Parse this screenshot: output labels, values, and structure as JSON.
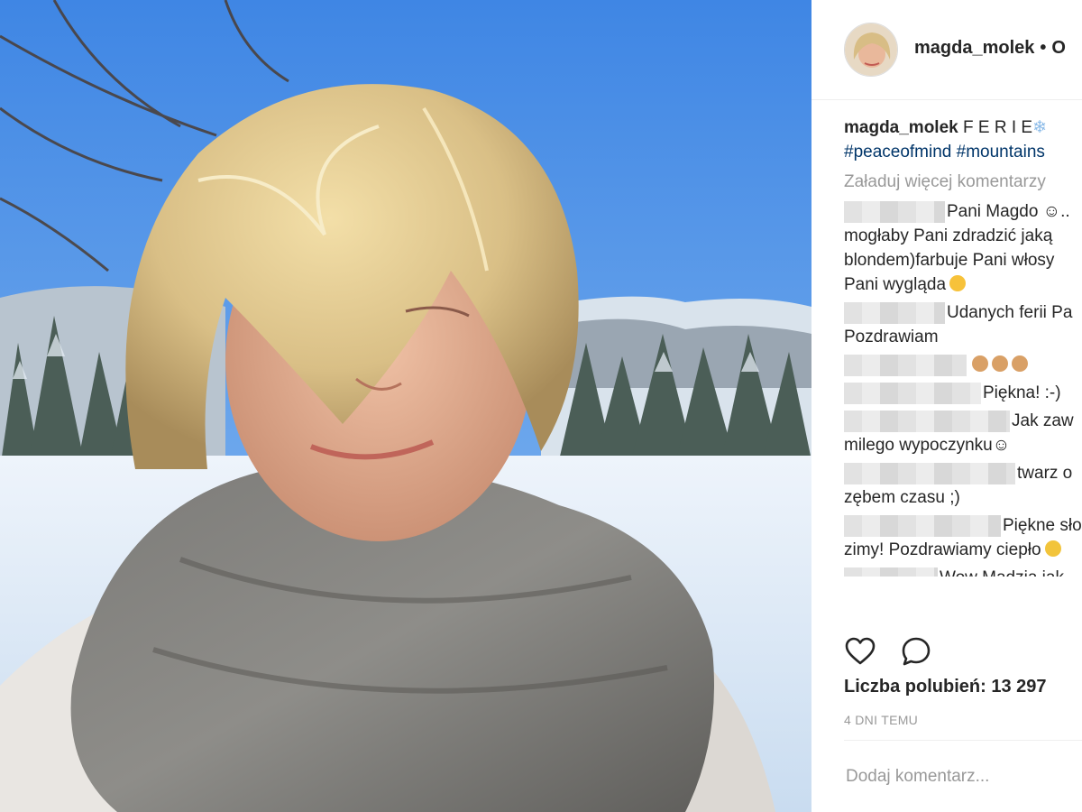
{
  "header": {
    "username": "magda_molek",
    "dot": "•",
    "follow_label": "O",
    "avatar_icon": "profile-avatar"
  },
  "caption": {
    "username": "magda_molek",
    "text": "F E R I E",
    "emoji_icon": "snowflake-emoji",
    "hashtags": [
      "#peaceofmind",
      "#mountains"
    ]
  },
  "load_more_label": "Załaduj więcej komentarzy",
  "comments": [
    {
      "lines": [
        "Pani Magdo ☺..",
        "mogłaby Pani zdradzić jaką",
        "blondem)farbuje Pani włosy",
        "Pani wygląda"
      ],
      "emoji": "heart-eyes-emoji"
    },
    {
      "lines": [
        "Udanych ferii Pa",
        "Pozdrawiam"
      ]
    },
    {
      "lines": [
        ""
      ],
      "emoji": "ok-hand-emoji-x3"
    },
    {
      "lines": [
        "Piękna! :-)"
      ]
    },
    {
      "lines": [
        "Jak zaw",
        "milego wypoczynku☺"
      ]
    },
    {
      "lines": [
        "twarz o",
        "zębem czasu ;)"
      ]
    },
    {
      "lines": [
        "Piękne sło",
        "zimy! Pozdrawiamy ciepło"
      ],
      "emoji": "yellow-heart-emoji"
    },
    {
      "lines": [
        "Wow Madzia jak"
      ]
    }
  ],
  "actions": {
    "like_icon": "heart-icon",
    "comment_icon": "comment-icon"
  },
  "likes_label": "Liczba polubień: 13 297",
  "time_label": "4 DNI TEMU",
  "add_comment_placeholder": "Dodaj komentarz...",
  "colors": {
    "hashtag": "#003569",
    "muted": "#999999",
    "text": "#262626",
    "sky": "#4f8fe0"
  }
}
